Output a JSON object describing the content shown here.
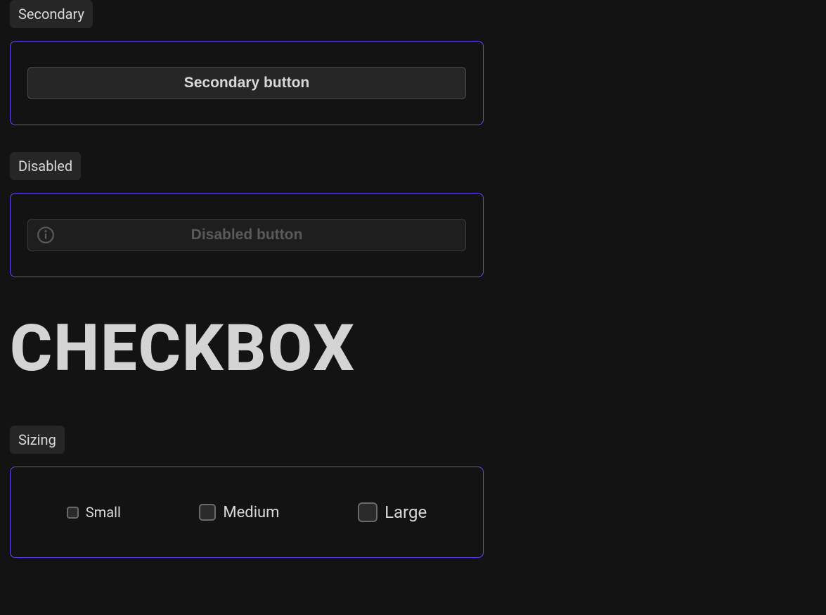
{
  "tags": {
    "secondary": "Secondary",
    "disabled": "Disabled",
    "sizing": "Sizing"
  },
  "buttons": {
    "secondary_label": "Secondary button",
    "disabled_label": "Disabled button"
  },
  "heading": {
    "checkbox": "CHECKBOX"
  },
  "checkboxes": {
    "small": "Small",
    "medium": "Medium",
    "large": "Large"
  },
  "icons": {
    "info": "info-icon"
  }
}
